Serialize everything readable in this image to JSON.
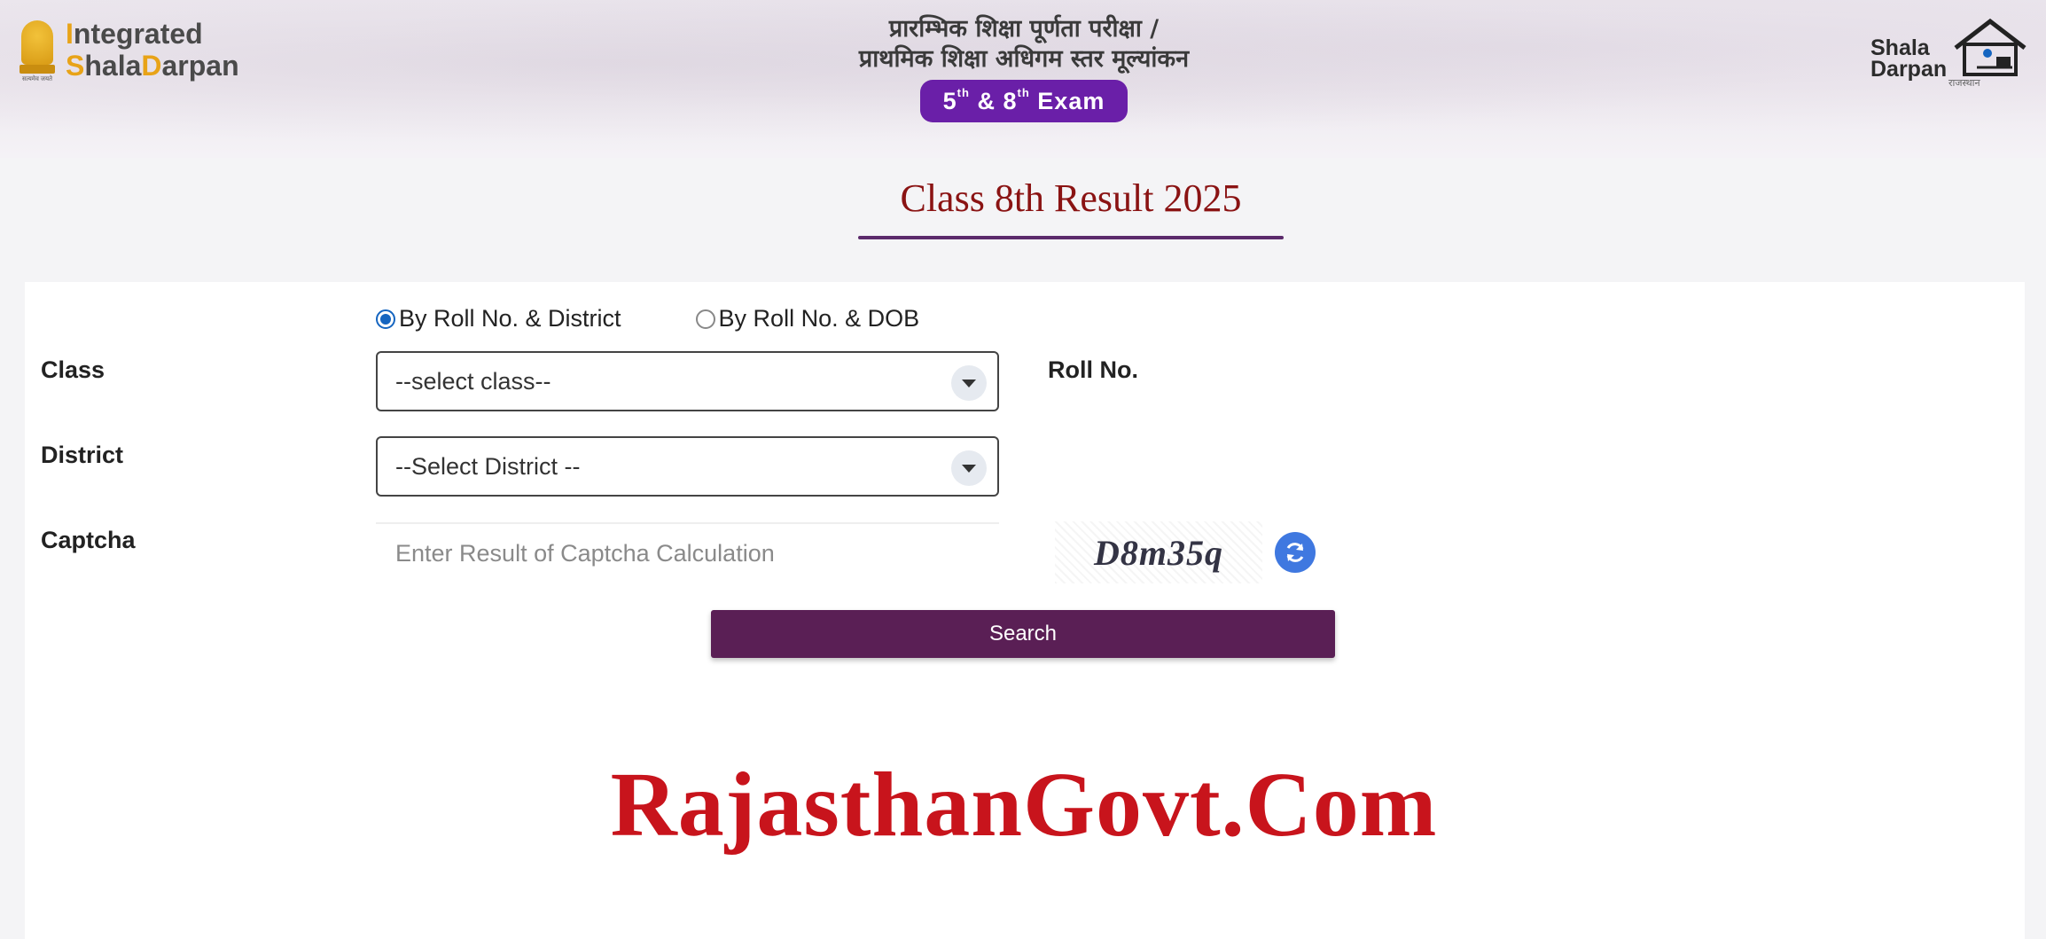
{
  "header": {
    "brand_line1_first": "I",
    "brand_line1_rest": "ntegrated",
    "brand_line2_first": "S",
    "brand_line2_mid": "hala",
    "brand_line2_d": "D",
    "brand_line2_rest": "arpan",
    "emblem_motto": "सत्यमेव जयते",
    "hindi_line1": "प्रारम्भिक शिक्षा पूर्णता परीक्षा /",
    "hindi_line2": "प्राथमिक शिक्षा अधिगम स्तर मूल्यांकन",
    "exam_5": "5",
    "exam_th1": "th",
    "exam_amp": "&",
    "exam_8": "8",
    "exam_th2": "th",
    "exam_word": "Exam",
    "right_logo_line1": "Shala",
    "right_logo_line2": "Darpan",
    "right_logo_sub": "राजस्थान",
    "accent": "#6a1fa8"
  },
  "page": {
    "title": "Class 8th Result 2025",
    "title_color": "#8a1313"
  },
  "form": {
    "radio_options": [
      {
        "label": "By Roll No. & District",
        "checked": true
      },
      {
        "label": "By Roll No. & DOB",
        "checked": false
      }
    ],
    "class_label": "Class",
    "class_select_value": "--select class--",
    "roll_label": "Roll No.",
    "district_label": "District",
    "district_select_value": "--Select District --",
    "captcha_label": "Captcha",
    "captcha_placeholder": "Enter Result of Captcha Calculation",
    "captcha_text": "D8m35q",
    "search_label": "Search",
    "button_color": "#5a1f55"
  },
  "watermark": {
    "text": "RajasthanGovt.Com",
    "color": "#c8141c"
  }
}
